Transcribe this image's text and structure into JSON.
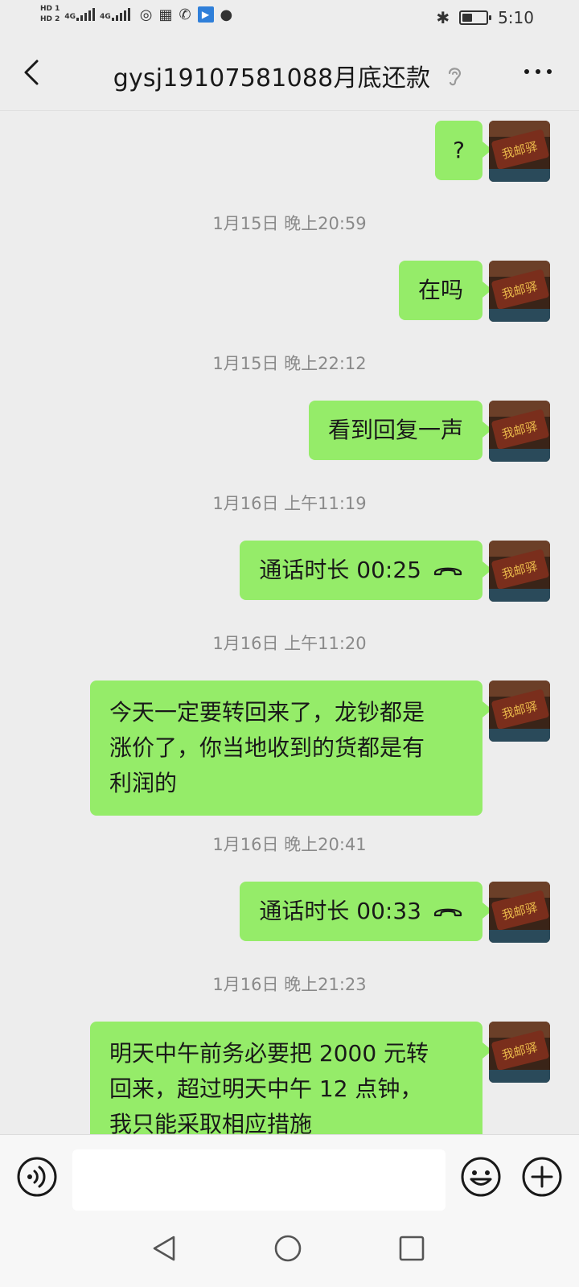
{
  "status_bar": {
    "hd1": "HD 1",
    "hd2": "HD 2",
    "net1": "4G",
    "net2": "4G",
    "time": "5:10",
    "battery_level": 0.5
  },
  "header": {
    "title": "gysj19107581088月底还款"
  },
  "messages": [
    {
      "type": "text",
      "text": "?"
    },
    {
      "type": "time",
      "text": "1月15日 晚上20:59"
    },
    {
      "type": "text",
      "text": "在吗"
    },
    {
      "type": "time",
      "text": "1月15日 晚上22:12"
    },
    {
      "type": "text",
      "text": "看到回复一声"
    },
    {
      "type": "time",
      "text": "1月16日 上午11:19"
    },
    {
      "type": "call",
      "text": "通话时长 00:25"
    },
    {
      "type": "time",
      "text": "1月16日 上午11:20"
    },
    {
      "type": "text",
      "lines": [
        "今天一定要转回来了，龙钞都是",
        "涨价了，你当地收到的货都是有",
        "利润的"
      ]
    },
    {
      "type": "time",
      "text": "1月16日 晚上20:41"
    },
    {
      "type": "call",
      "text": "通话时长 00:33"
    },
    {
      "type": "time",
      "text": "1月16日 晚上21:23"
    },
    {
      "type": "text",
      "lines": [
        "明天中午前务必要把 2000 元转",
        "回来，超过明天中午 12 点钟，",
        "我只能采取相应措施"
      ]
    }
  ],
  "avatar_sign_text": "我邮驿",
  "icons": {
    "back": "chevron-left-icon",
    "ear": "ear-icon",
    "more": "more-icon",
    "voice": "voice-icon",
    "emoji": "emoji-icon",
    "plus": "plus-icon",
    "call": "phone-hangup-icon"
  },
  "colors": {
    "bubble": "#95ec69",
    "background": "#ededed"
  }
}
